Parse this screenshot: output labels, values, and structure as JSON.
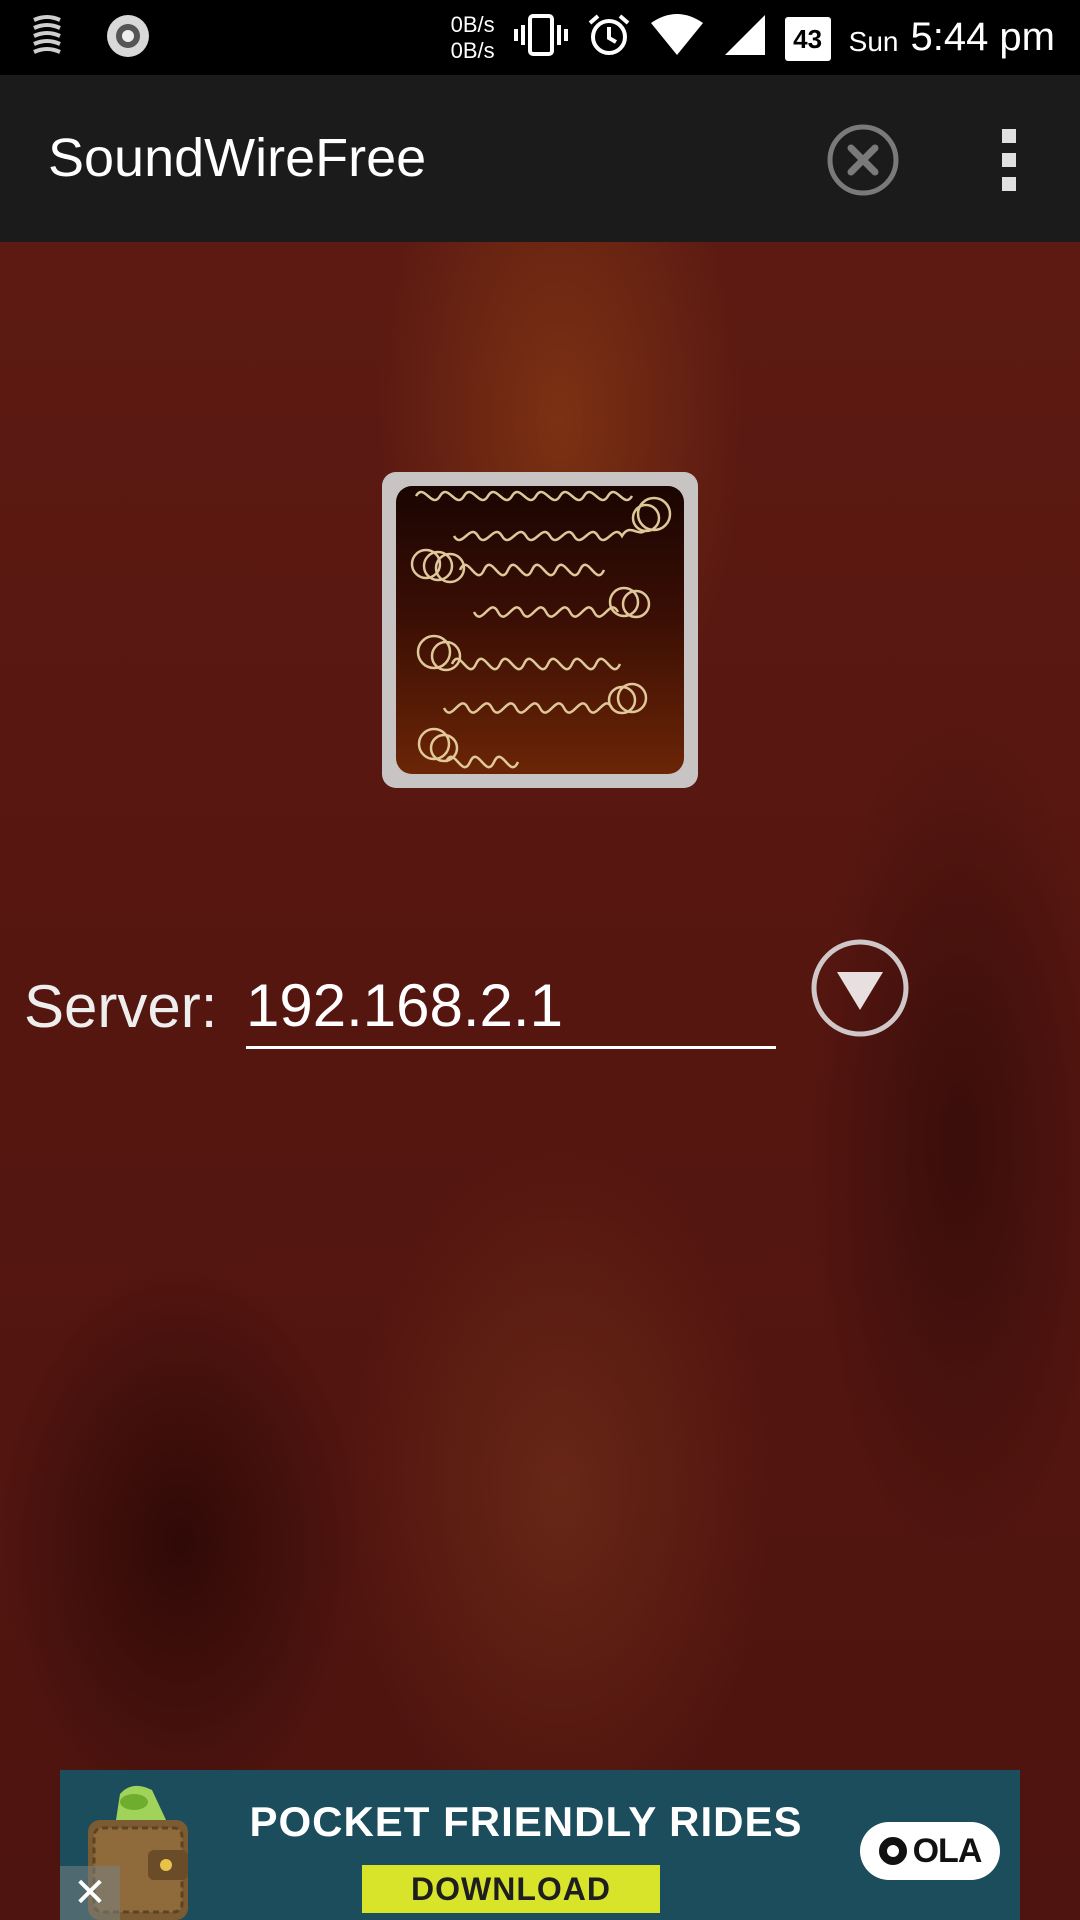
{
  "status_bar": {
    "left_icons": [
      "soundwire-spring-icon",
      "eye-icon"
    ],
    "net_speed_up": "0B/s",
    "net_speed_down": "0B/s",
    "right_icons": [
      "vibrate-icon",
      "alarm-icon",
      "wifi-icon",
      "cell-signal-icon",
      "battery-icon"
    ],
    "battery_level": "43",
    "day": "Sun",
    "time": "5:44 pm"
  },
  "app_bar": {
    "title": "SoundWireFree",
    "close_icon": "close-circle-icon",
    "menu_icon": "overflow-menu-icon"
  },
  "main": {
    "logo_icon": "soundwire-spring-logo",
    "server_label": "Server:",
    "server_value": "192.168.2.1",
    "dropdown_icon": "dropdown-arrow-icon"
  },
  "ad": {
    "headline": "POCKET FRIENDLY RIDES",
    "cta": "DOWNLOAD",
    "brand": "OLA",
    "close_glyph": "✕",
    "colors": {
      "background": "#1c4d5c",
      "cta": "#d7e42a"
    }
  },
  "colors": {
    "status_bar": "#000000",
    "app_bar": "#1b1b1b",
    "background": "#561610",
    "text": "#ffffff"
  }
}
